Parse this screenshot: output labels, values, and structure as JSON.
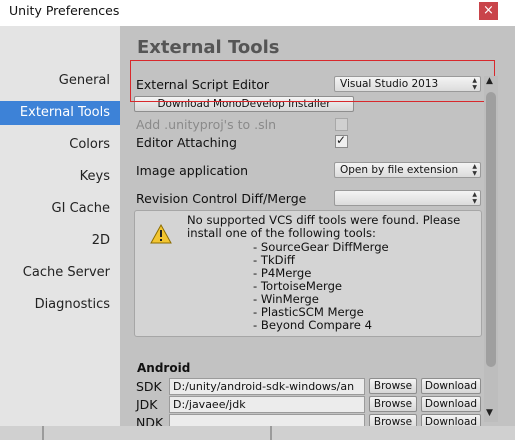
{
  "window": {
    "title": "Unity Preferences",
    "close_glyph": "×"
  },
  "sidebar": {
    "items": [
      {
        "label": "General"
      },
      {
        "label": "External Tools"
      },
      {
        "label": "Colors"
      },
      {
        "label": "Keys"
      },
      {
        "label": "GI Cache"
      },
      {
        "label": "2D"
      },
      {
        "label": "Cache Server"
      },
      {
        "label": "Diagnostics"
      }
    ],
    "active_index": 1
  },
  "main": {
    "heading": "External Tools",
    "script_editor": {
      "label": "External Script Editor",
      "value": "Visual Studio 2013"
    },
    "download_button": "Download MonoDevelop Installer",
    "add_unityproj": {
      "label": "Add .unityproj's to .sln",
      "checked": false,
      "enabled": false
    },
    "editor_attaching": {
      "label": "Editor Attaching",
      "checked": true,
      "checkmark": "✓"
    },
    "image_application": {
      "label": "Image application",
      "value": "Open by file extension"
    },
    "revision_control": {
      "label": "Revision Control Diff/Merge",
      "value": ""
    },
    "vcs_warning": {
      "icon": "warning-icon",
      "line1": "No supported VCS diff tools were found. Please",
      "line2": "install one of the following tools:",
      "tools": [
        "- SourceGear DiffMerge",
        "- TkDiff",
        "- P4Merge",
        "- TortoiseMerge",
        "- WinMerge",
        "- PlasticSCM Merge",
        "- Beyond Compare 4"
      ]
    },
    "android": {
      "heading": "Android",
      "sdk": {
        "label": "SDK",
        "value": "D:/unity/android-sdk-windows/an"
      },
      "jdk": {
        "label": "JDK",
        "value": "D:/javaee/jdk"
      },
      "ndk": {
        "label": "NDK",
        "value": ""
      },
      "browse_label": "Browse",
      "download_label": "Download"
    }
  },
  "colors": {
    "accent": "#3d82d7",
    "close": "#c9444a",
    "highlight": "#d8282c"
  }
}
